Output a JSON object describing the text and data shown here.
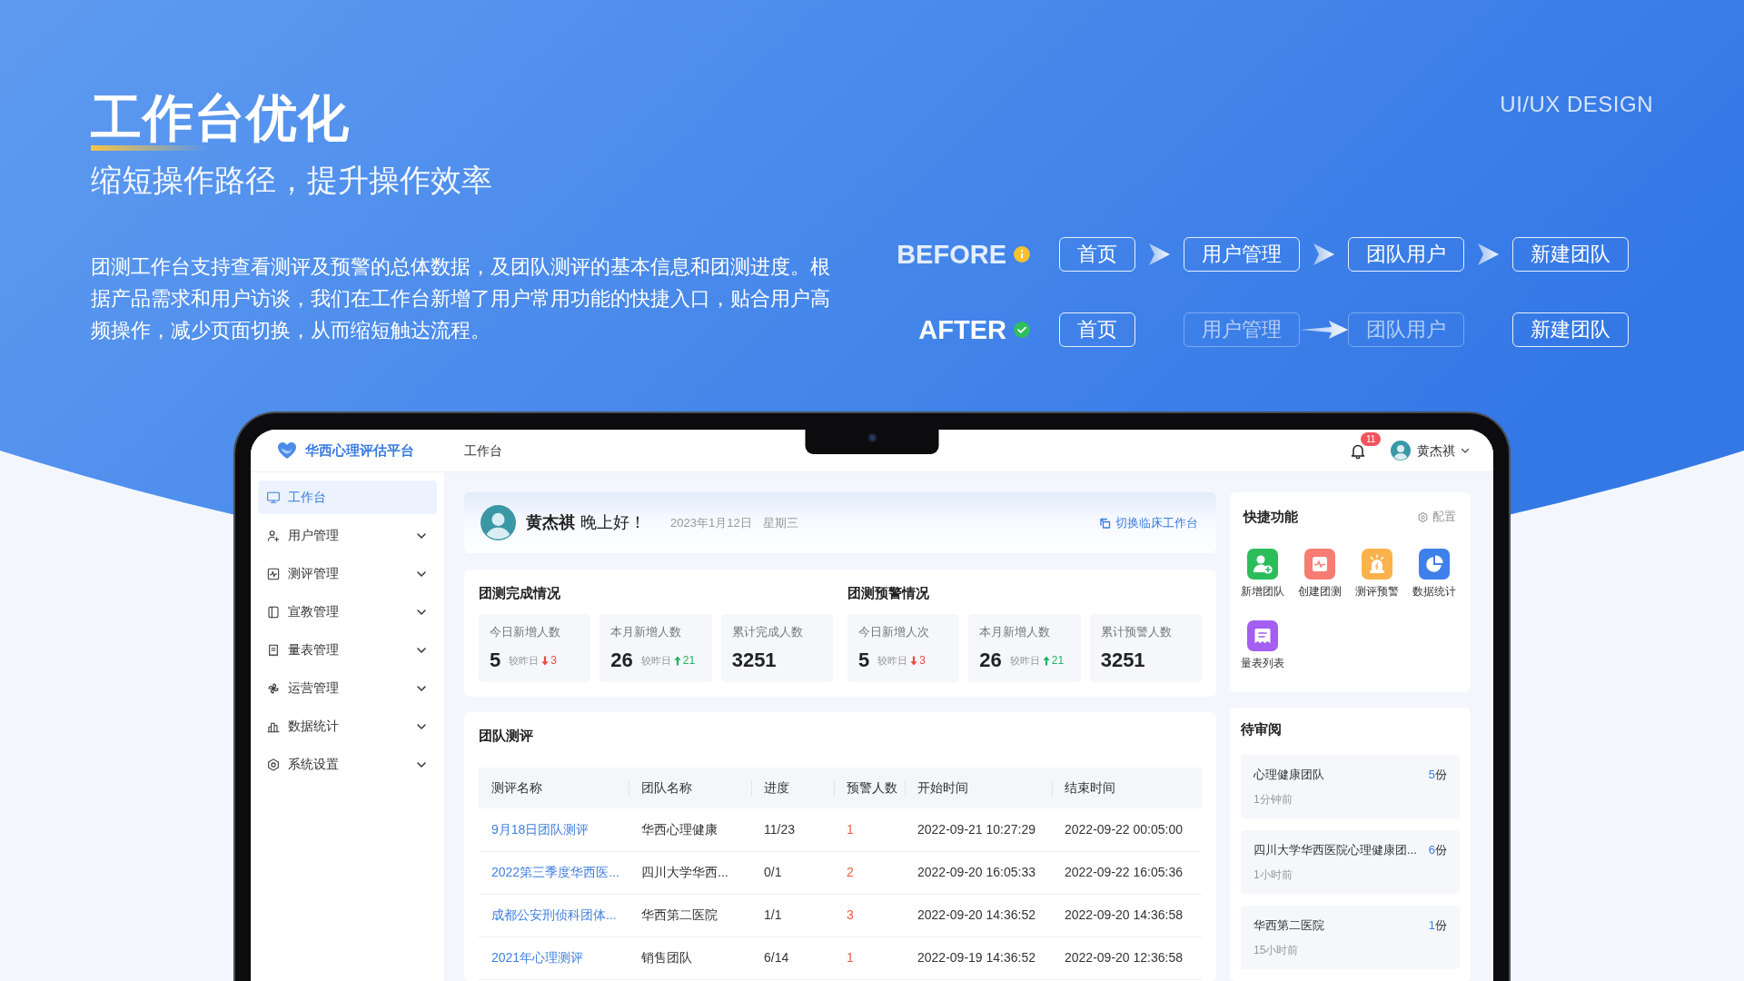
{
  "header": {
    "title": "工作台优化",
    "subtitle": "缩短操作路径，提升操作效率",
    "tag": "UI/UX DESIGN",
    "description": "团测工作台支持查看测评及预警的总体数据，及团队测评的基本信息和团测进度。根据产品需求和用户访谈，我们在工作台新增了用户常用功能的快捷入口，贴合用户高频操作，减少页面切换，从而缩短触达流程。"
  },
  "flows": [
    {
      "label": "BEFORE",
      "kind": "before",
      "steps": [
        {
          "label": "首页",
          "faded": false
        },
        {
          "label": "用户管理",
          "faded": false
        },
        {
          "label": "团队用户",
          "faded": false
        },
        {
          "label": "新建团队",
          "faded": false
        }
      ]
    },
    {
      "label": "AFTER",
      "kind": "after",
      "steps": [
        {
          "label": "首页",
          "faded": false
        },
        {
          "label": "用户管理",
          "faded": true
        },
        {
          "label": "团队用户",
          "faded": true
        },
        {
          "label": "新建团队",
          "faded": false
        }
      ]
    }
  ],
  "app": {
    "brand": "华西心理评估平台",
    "page_title": "工作台",
    "notifications": "11",
    "user": "黄杰祺",
    "sidebar": {
      "items": [
        {
          "label": "工作台",
          "selected": true,
          "expandable": false
        },
        {
          "label": "用户管理",
          "selected": false,
          "expandable": true
        },
        {
          "label": "测评管理",
          "selected": false,
          "expandable": true
        },
        {
          "label": "宣教管理",
          "selected": false,
          "expandable": true
        },
        {
          "label": "量表管理",
          "selected": false,
          "expandable": true
        },
        {
          "label": "运营管理",
          "selected": false,
          "expandable": true
        },
        {
          "label": "数据统计",
          "selected": false,
          "expandable": true
        },
        {
          "label": "系统设置",
          "selected": false,
          "expandable": true
        }
      ]
    },
    "greeting": {
      "name": "黄杰祺",
      "text": "晚上好！",
      "date": "2023年1月12日",
      "weekday": "星期三",
      "link": "切换临床工作台"
    },
    "stat_groups": [
      {
        "title": "团测完成情况",
        "items": [
          {
            "label": "今日新增人数",
            "value": "5",
            "compare_label": "较昨日",
            "increase": false,
            "delta": "3"
          },
          {
            "label": "本月新增人数",
            "value": "26",
            "compare_label": "较昨日",
            "increase": true,
            "delta": "21"
          },
          {
            "label": "累计完成人数",
            "value": "3251"
          }
        ]
      },
      {
        "title": "团测预警情况",
        "items": [
          {
            "label": "今日新增人次",
            "value": "5",
            "compare_label": "较昨日",
            "increase": false,
            "delta": "3"
          },
          {
            "label": "本月新增人数",
            "value": "26",
            "compare_label": "较昨日",
            "increase": true,
            "delta": "21"
          },
          {
            "label": "累计预警人数",
            "value": "3251"
          }
        ]
      }
    ],
    "team_tests": {
      "title": "团队测评",
      "columns": [
        {
          "label": "测评名称",
          "kind": "link"
        },
        {
          "label": "团队名称",
          "kind": "text"
        },
        {
          "label": "进度",
          "kind": "text"
        },
        {
          "label": "预警人数",
          "kind": "alert"
        },
        {
          "label": "开始时间",
          "kind": "text"
        },
        {
          "label": "结束时间",
          "kind": "text"
        }
      ],
      "rows": [
        [
          "9月18日团队测评",
          "华西心理健康",
          "11/23",
          "1",
          "2022-09-21 10:27:29",
          "2022-09-22 00:05:00"
        ],
        [
          "2022第三季度华西医...",
          "四川大学华西...",
          "0/1",
          "2",
          "2022-09-20 16:05:33",
          "2022-09-22 16:05:36"
        ],
        [
          "成都公安刑侦科团体...",
          "华西第二医院",
          "1/1",
          "3",
          "2022-09-20 14:36:52",
          "2022-09-20 14:36:58"
        ],
        [
          "2021年心理测评",
          "销售团队",
          "6/14",
          "1",
          "2022-09-19 14:36:52",
          "2022-09-20 12:36:58"
        ]
      ]
    },
    "quick_functions": {
      "title": "快捷功能",
      "config": "配置",
      "items": [
        {
          "label": "新增团队",
          "color": "#2cbd5b"
        },
        {
          "label": "创建团测",
          "color": "#f67c74"
        },
        {
          "label": "测评预警",
          "color": "#fbb24c"
        },
        {
          "label": "数据统计",
          "color": "#3d80ea"
        },
        {
          "label": "量表列表",
          "color": "#a35ff2"
        }
      ]
    },
    "pending_review": {
      "title": "待审阅",
      "items": [
        {
          "name": "心理健康团队",
          "count": "5",
          "unit": "份",
          "time": "1分钟前"
        },
        {
          "name": "四川大学华西医院心理健康团...",
          "count": "6",
          "unit": "份",
          "time": "1小时前"
        },
        {
          "name": "华西第二医院",
          "count": "1",
          "unit": "份",
          "time": "15小时前"
        }
      ]
    }
  }
}
